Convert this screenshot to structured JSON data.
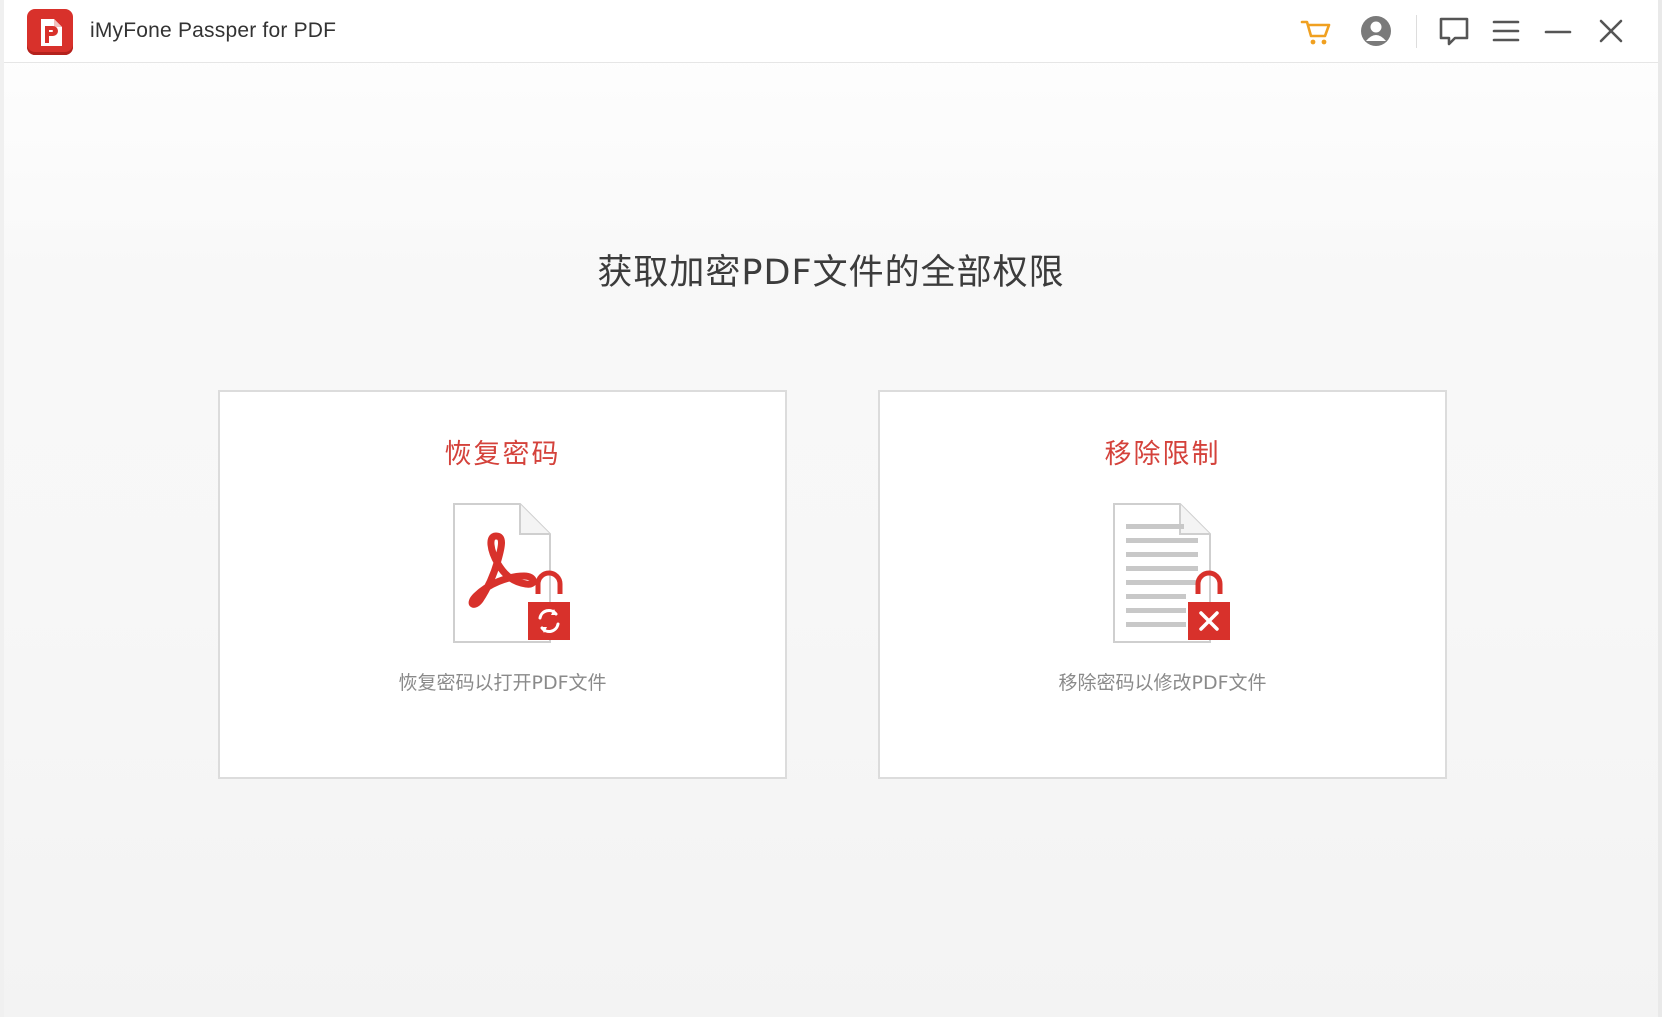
{
  "app": {
    "title": "iMyFone Passper for PDF",
    "accent_color": "#d8312b"
  },
  "toolbar": {
    "icons": [
      {
        "name": "cart-icon",
        "color": "#f0a020"
      },
      {
        "name": "account-icon",
        "color": "#7a7a7a"
      },
      {
        "name": "feedback-icon",
        "color": "#555555"
      },
      {
        "name": "menu-icon",
        "color": "#555555"
      },
      {
        "name": "minimize-icon",
        "color": "#555555"
      },
      {
        "name": "close-icon",
        "color": "#555555"
      }
    ]
  },
  "main": {
    "heading": "获取加密PDF文件的全部权限",
    "cards": [
      {
        "title": "恢复密码",
        "description": "恢复密码以打开PDF文件",
        "icon": "pdf-lock-refresh-icon"
      },
      {
        "title": "移除限制",
        "description": "移除密码以修改PDF文件",
        "icon": "document-lock-remove-icon"
      }
    ]
  }
}
